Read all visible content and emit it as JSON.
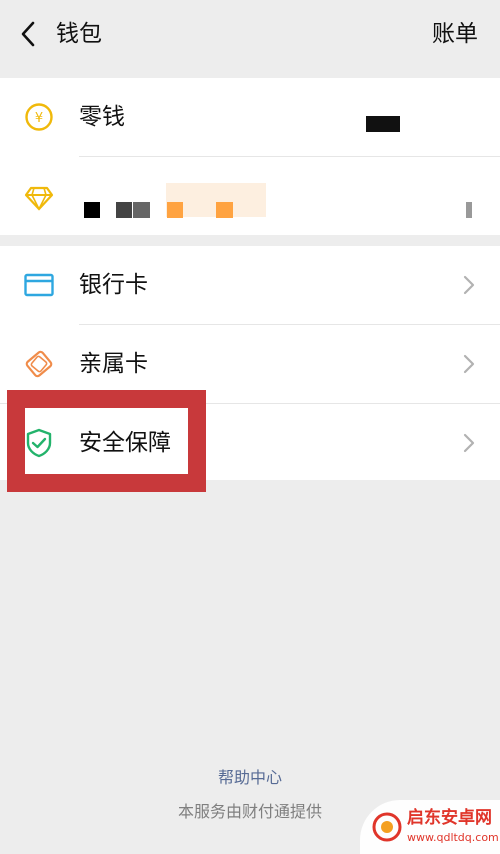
{
  "header": {
    "title": "钱包",
    "bill_label": "账单"
  },
  "wallet": {
    "change_label": "零钱"
  },
  "menu": {
    "bank_card_label": "银行卡",
    "family_card_label": "亲属卡",
    "security_label": "安全保障"
  },
  "footer": {
    "help_label": "帮助中心",
    "provider_text": "本服务由财付通提供"
  },
  "watermark": {
    "text": "启东安卓网",
    "url": "www.qdltdq.com"
  },
  "colors": {
    "background": "#ededed",
    "link": "#576b95",
    "coin_yellow": "#f0b90b",
    "card_blue": "#2ea7e0",
    "family_orange": "#f08c4a",
    "shield_green": "#23b36b",
    "highlight_red": "#c8393b"
  },
  "icons": {
    "back": "chevron-left-icon",
    "change": "yen-coin-icon",
    "points": "diamond-icon",
    "bank_card": "bank-card-icon",
    "family_card": "family-card-icon",
    "security": "shield-check-icon"
  }
}
